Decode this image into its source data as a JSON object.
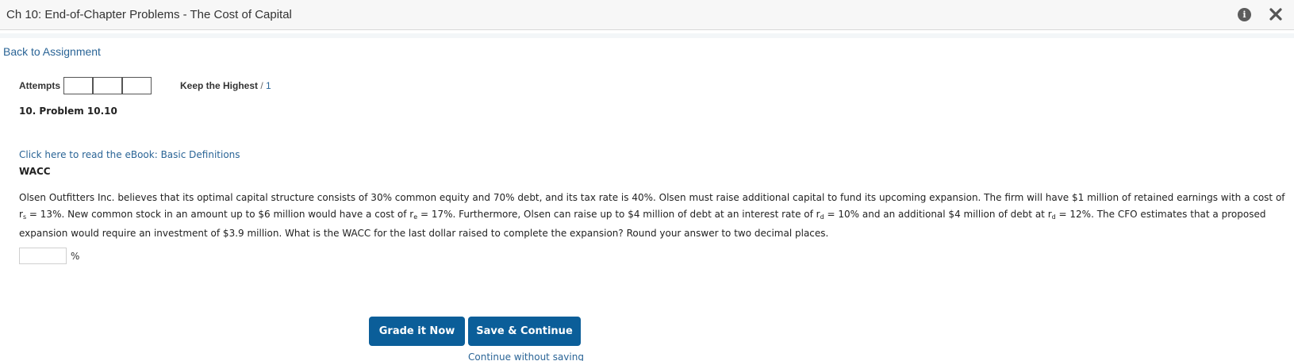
{
  "window": {
    "title": "Ch 10: End-of-Chapter Problems - The Cost of Capital"
  },
  "nav": {
    "back_link": "Back to Assignment"
  },
  "attempts": {
    "label": "Attempts",
    "boxes": [
      "",
      "",
      ""
    ],
    "keep_label": "Keep the Highest",
    "separator": " / ",
    "keep_value": "1"
  },
  "problem": {
    "title": "10.  Problem 10.10",
    "ebook_link": "Click here to read the eBook: Basic Definitions",
    "heading": "WACC",
    "text": {
      "p1": "Olsen Outfitters Inc. believes that its optimal capital structure consists of 30% common equity and 70% debt, and its tax rate is 40%. Olsen must raise additional capital to fund its upcoming expansion. The firm will have $1 million of retained earnings with a cost of r",
      "sub_s": "s",
      "p2": " = 13%. New common stock in an amount up to $6 million would have a cost of r",
      "sub_e": "e",
      "p3": " = 17%. Furthermore, Olsen can raise up to $4 million of debt at an interest rate of r",
      "sub_d1": "d",
      "p4": " = 10% and an additional $4 million of debt at r",
      "sub_d2": "d",
      "p5": " = 12%. The CFO estimates that a proposed expansion would require an investment of $3.9 million. What is the WACC for the last dollar raised to complete the expansion? Round your answer to two decimal places."
    },
    "answer": {
      "value": "",
      "unit": "%"
    }
  },
  "actions": {
    "grade_label": "Grade it Now",
    "save_label": "Save & Continue",
    "continue_label": "Continue without saving"
  },
  "colors": {
    "button": "#0b5e99",
    "link": "#2a6496",
    "titlebar": "#f7f7f7"
  }
}
